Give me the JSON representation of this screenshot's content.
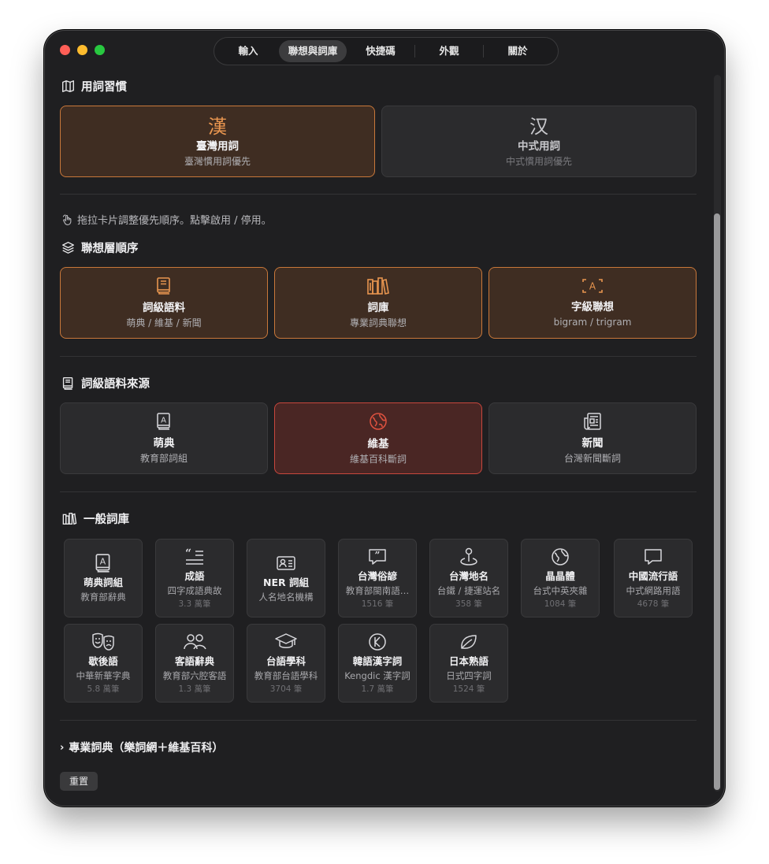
{
  "tabs": [
    "輸入",
    "聯想與詞庫",
    "快捷碼",
    "外觀",
    "關於"
  ],
  "active_tab": "聯想與詞庫",
  "usage": {
    "section_title": "用詞習慣",
    "options": [
      {
        "glyph": "漢",
        "title": "臺灣用詞",
        "sub": "臺灣慣用詞優先",
        "selected": true
      },
      {
        "glyph": "汉",
        "title": "中式用詞",
        "sub": "中式慣用詞優先",
        "selected": false
      }
    ]
  },
  "hint": "拖拉卡片調整優先順序。點擊啟用 / 停用。",
  "layers": {
    "section_title": "聯想層順序",
    "cards": [
      {
        "icon": "book-icon",
        "title": "詞級語料",
        "sub": "萌典 / 維基 / 新聞"
      },
      {
        "icon": "books-icon",
        "title": "詞庫",
        "sub": "專業詞典聯想"
      },
      {
        "icon": "character-box-icon",
        "title": "字級聯想",
        "sub": "bigram / trigram"
      }
    ]
  },
  "sources": {
    "section_title": "詞級語料來源",
    "cards": [
      {
        "icon": "dictionary-icon",
        "title": "萌典",
        "sub": "教育部詞組"
      },
      {
        "icon": "globe-icon",
        "title": "維基",
        "sub": "維基百科斷詞"
      },
      {
        "icon": "newspaper-icon",
        "title": "新聞",
        "sub": "台灣新聞斷詞"
      }
    ]
  },
  "general": {
    "section_title": "一般詞庫",
    "items": [
      {
        "icon": "dictionary-icon",
        "title": "萌典詞組",
        "sub": "教育部辭典",
        "count": ""
      },
      {
        "icon": "quote-icon",
        "title": "成語",
        "sub": "四字成語典故",
        "count": "3.3 萬筆"
      },
      {
        "icon": "id-card-icon",
        "title": "NER 詞組",
        "sub": "人名地名機構",
        "count": ""
      },
      {
        "icon": "speech-quote-icon",
        "title": "台灣俗諺",
        "sub": "教育部閩南語…",
        "count": "1516 筆"
      },
      {
        "icon": "map-pin-icon",
        "title": "台灣地名",
        "sub": "台鐵 / 捷運站名",
        "count": "358 筆"
      },
      {
        "icon": "globe-icon",
        "title": "晶晶體",
        "sub": "台式中英夾雜",
        "count": "1084 筆"
      },
      {
        "icon": "chat-bubble-icon",
        "title": "中國流行語",
        "sub": "中式網路用語",
        "count": "4678 筆"
      },
      {
        "icon": "theater-masks-icon",
        "title": "歇後語",
        "sub": "中華新華字典",
        "count": "5.8 萬筆"
      },
      {
        "icon": "people-icon",
        "title": "客語辭典",
        "sub": "教育部六腔客語",
        "count": "1.3 萬筆"
      },
      {
        "icon": "graduation-cap-icon",
        "title": "台語學科",
        "sub": "教育部台語學科",
        "count": "3704 筆"
      },
      {
        "icon": "k-circle-icon",
        "title": "韓語漢字詞",
        "sub": "Kengdic 漢字詞",
        "count": "1.7 萬筆"
      },
      {
        "icon": "leaf-icon",
        "title": "日本熟語",
        "sub": "日式四字詞",
        "count": "1524 筆"
      }
    ]
  },
  "expander": "專業詞典（樂詞網＋維基百科）",
  "reset": "重置"
}
